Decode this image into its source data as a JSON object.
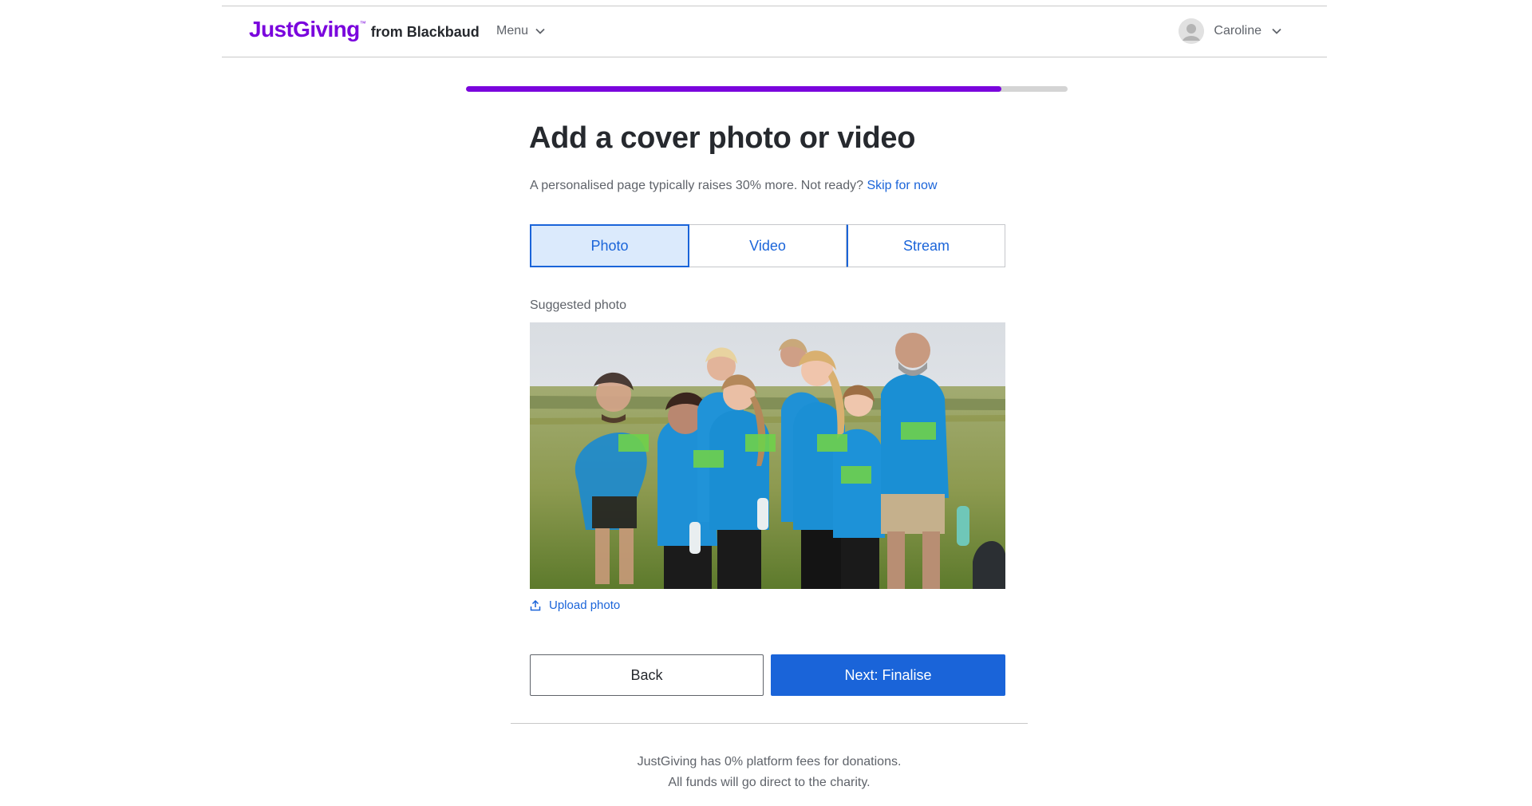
{
  "header": {
    "logo_main": "JustGiving",
    "logo_tm": "™",
    "logo_sub": "from Blackbaud",
    "menu_label": "Menu",
    "user_name": "Caroline"
  },
  "progress": {
    "fraction": 0.89
  },
  "main": {
    "title": "Add a cover photo or video",
    "subtitle": "A personalised page typically raises 30% more. Not ready?",
    "skip_label": "Skip for now",
    "tabs": [
      {
        "label": "Photo",
        "active": true
      },
      {
        "label": "Video",
        "active": false
      },
      {
        "label": "Stream",
        "active": false
      }
    ],
    "photo_label": "Suggested photo",
    "upload_label": "Upload photo",
    "back_label": "Back",
    "next_label": "Next: Finalise"
  },
  "footer": {
    "line1": "JustGiving has 0% platform fees for donations.",
    "line2": "All funds will go direct to the charity."
  },
  "colors": {
    "brand_purple": "#7a04dd",
    "primary_blue": "#1a64d9",
    "tab_active_bg": "#dbeafc"
  },
  "icons": {
    "menu": "chevron-down-icon",
    "user": "avatar-icon",
    "upload": "upload-icon"
  }
}
